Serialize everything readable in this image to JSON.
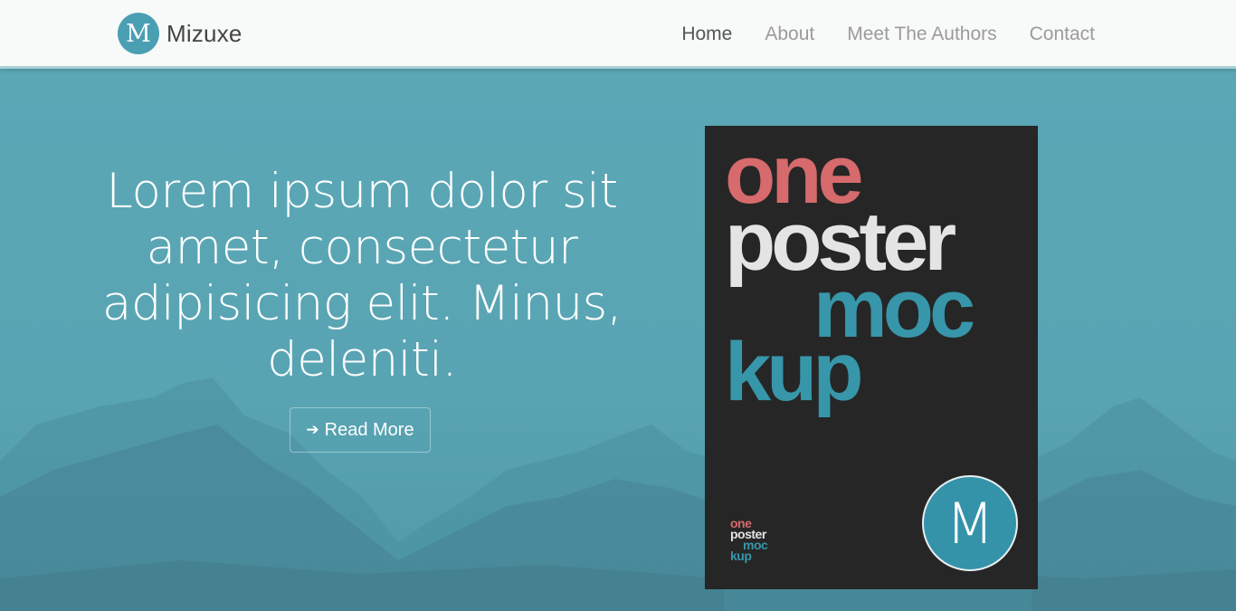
{
  "navbar": {
    "brand_logo_letter": "M",
    "brand_name": "Mizuxe",
    "links": [
      {
        "label": "Home",
        "active": true
      },
      {
        "label": "About",
        "active": false
      },
      {
        "label": "Meet The Authors",
        "active": false
      },
      {
        "label": "Contact",
        "active": false
      }
    ]
  },
  "hero": {
    "headline": "Lorem ipsum dolor sit amet, consectetur adipisicing elit. Minus, deleniti.",
    "read_more_icon": "arrow-right-icon",
    "read_more_label": "Read More"
  },
  "poster": {
    "word1": "one",
    "word2": "poster",
    "word3": "moc",
    "word4": "kup",
    "badge_letter": "M"
  },
  "colors": {
    "accent": "#3796a9",
    "hero_bg": "#5aa6b5",
    "poster_red": "#d66a6c",
    "poster_bg": "#262626"
  }
}
